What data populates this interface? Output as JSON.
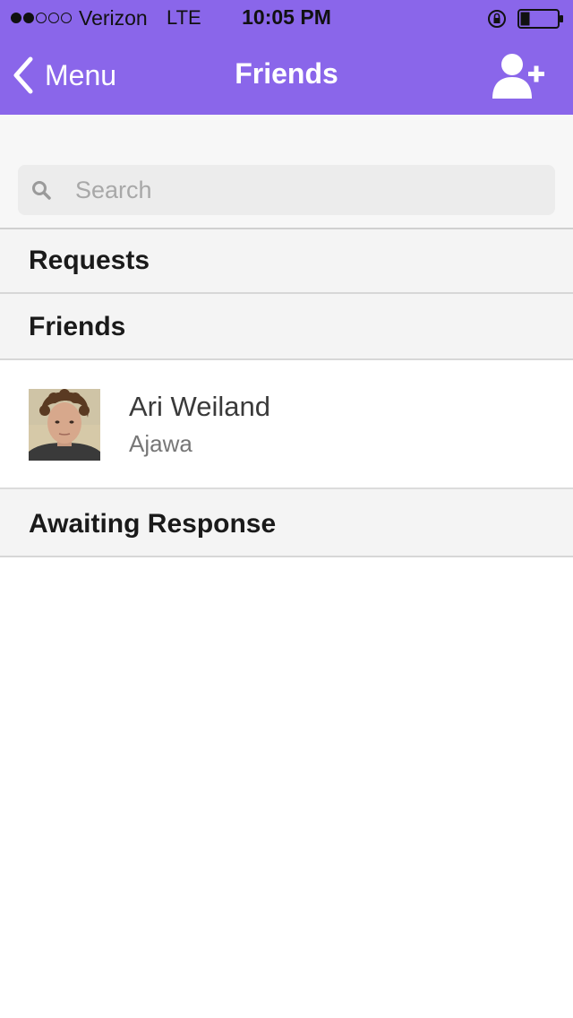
{
  "status_bar": {
    "carrier": "Verizon",
    "network": "LTE",
    "time": "10:05 PM",
    "signal_bars_filled": 2,
    "signal_bars_total": 5,
    "battery_level": 0.25
  },
  "nav": {
    "back_label": "Menu",
    "title": "Friends",
    "back_icon": "chevron-left-icon",
    "add_icon": "add-user-icon"
  },
  "search": {
    "placeholder": "Search",
    "value": ""
  },
  "sections": {
    "requests": "Requests",
    "friends": "Friends",
    "awaiting": "Awaiting Response"
  },
  "friends": [
    {
      "name": "Ari Weiland",
      "username": "Ajawa"
    }
  ],
  "colors": {
    "brand": "#8a66ea",
    "section_bg": "#f4f4f4"
  }
}
